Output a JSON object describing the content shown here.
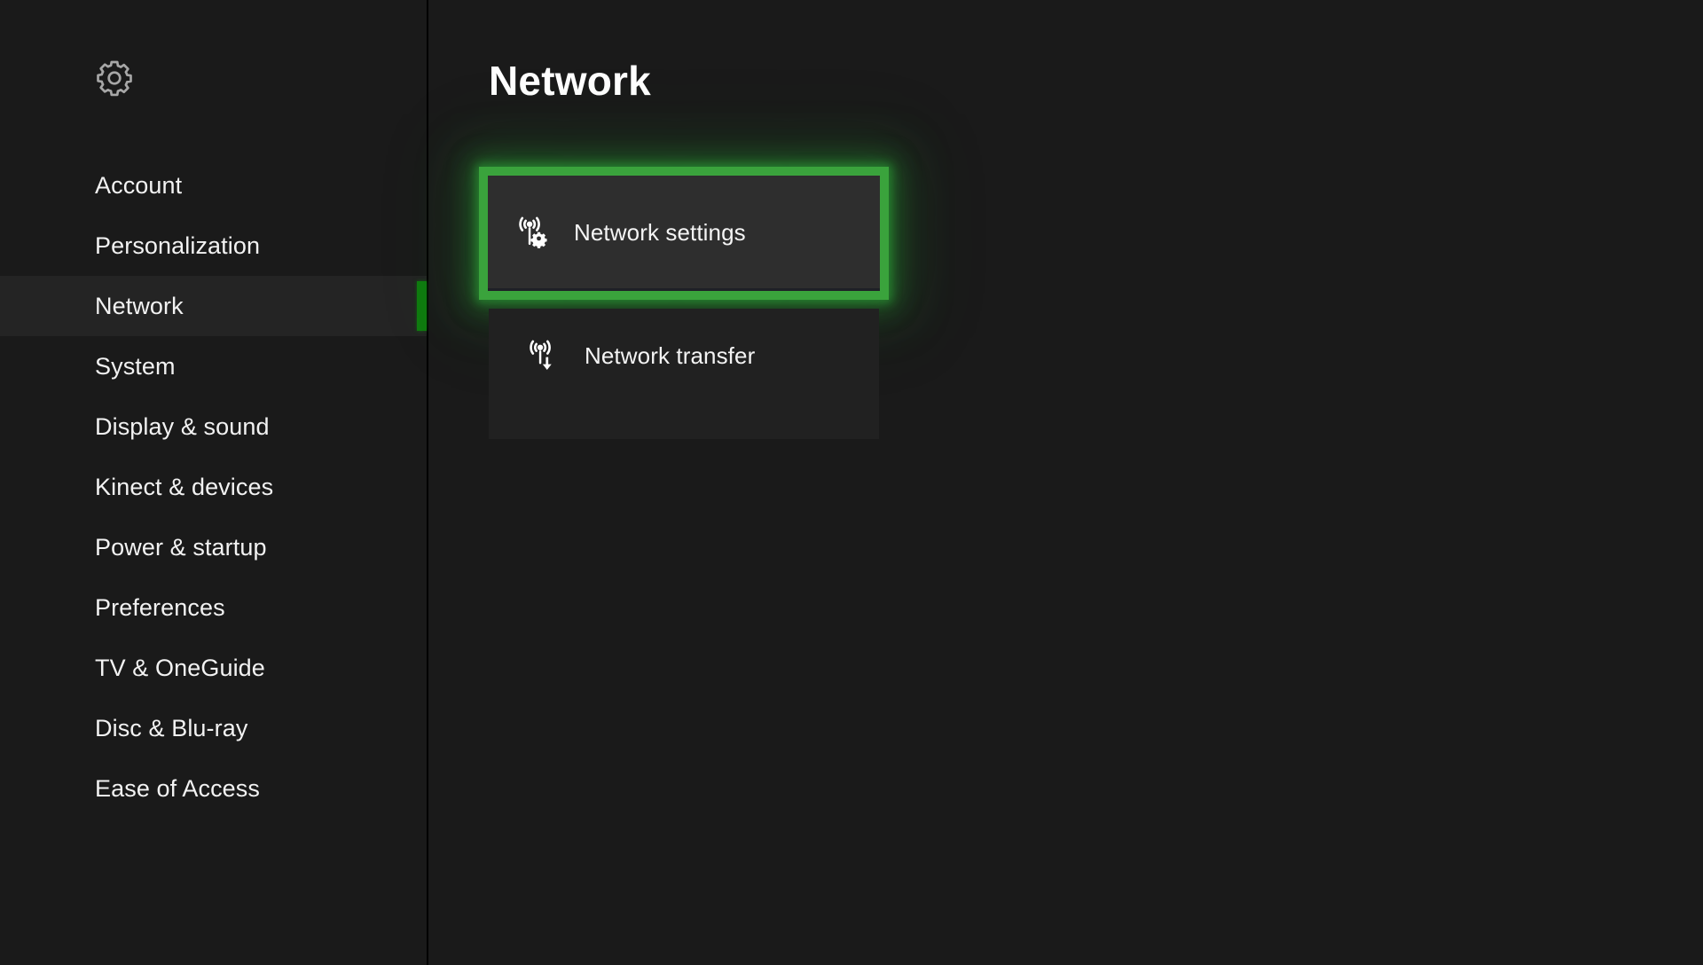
{
  "app": {
    "title": "Settings",
    "accent_green": "#107c10",
    "focus_green": "#3aa33c",
    "background": "#1a1a1a",
    "tile_background": "#2e2e2e",
    "selected_row_background": "#242424"
  },
  "sidebar": {
    "header_icon": "gear-icon",
    "selected_index": 2,
    "items": [
      {
        "label": "Account",
        "icon": "none",
        "selected": false
      },
      {
        "label": "Personalization",
        "icon": "none",
        "selected": false
      },
      {
        "label": "Network",
        "icon": "none",
        "selected": true
      },
      {
        "label": "System",
        "icon": "none",
        "selected": false
      },
      {
        "label": "Display & sound",
        "icon": "none",
        "selected": false
      },
      {
        "label": "Kinect & devices",
        "icon": "none",
        "selected": false
      },
      {
        "label": "Power & startup",
        "icon": "none",
        "selected": false
      },
      {
        "label": "Preferences",
        "icon": "none",
        "selected": false
      },
      {
        "label": "TV & OneGuide",
        "icon": "none",
        "selected": false
      },
      {
        "label": "Disc & Blu-ray",
        "icon": "none",
        "selected": false
      },
      {
        "label": "Ease of Access",
        "icon": "none",
        "selected": false
      }
    ]
  },
  "main": {
    "page_title": "Network",
    "tiles": [
      {
        "label": "Network settings",
        "icon": "network-settings-icon",
        "focused": true
      },
      {
        "label": "Network transfer",
        "icon": "network-transfer-icon",
        "focused": false
      }
    ]
  }
}
